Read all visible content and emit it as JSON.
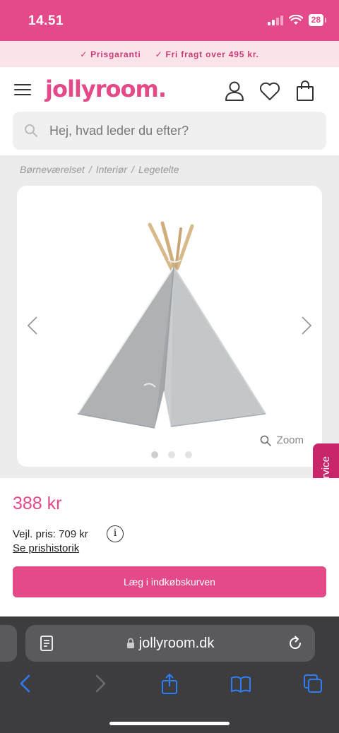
{
  "status_bar": {
    "time": "14.51",
    "battery": "28"
  },
  "usp": {
    "items": [
      "Prisgaranti",
      "Fri fragt over 495 kr."
    ]
  },
  "header": {
    "logo": "jollyroom."
  },
  "search": {
    "placeholder": "Hej, hvad leder du efter?"
  },
  "breadcrumb": {
    "items": [
      "Børneværelset",
      "Interiør",
      "Legetelte"
    ]
  },
  "gallery": {
    "zoom_label": "Zoom",
    "image_count": 3,
    "active_index": 0
  },
  "side_tab": {
    "label": "Kundeservice"
  },
  "product": {
    "price": "388 kr",
    "rrp": "Vejl. pris: 709 kr",
    "history_link": "Se prishistorik",
    "add_to_cart": "Læg i indkøbskurven"
  },
  "browser": {
    "url": "jollyroom.dk"
  },
  "colors": {
    "brand": "#e4498a",
    "usp_background": "#fbe3ea",
    "side_tab": "#c8256b",
    "browser_accent": "#2f7df6"
  }
}
